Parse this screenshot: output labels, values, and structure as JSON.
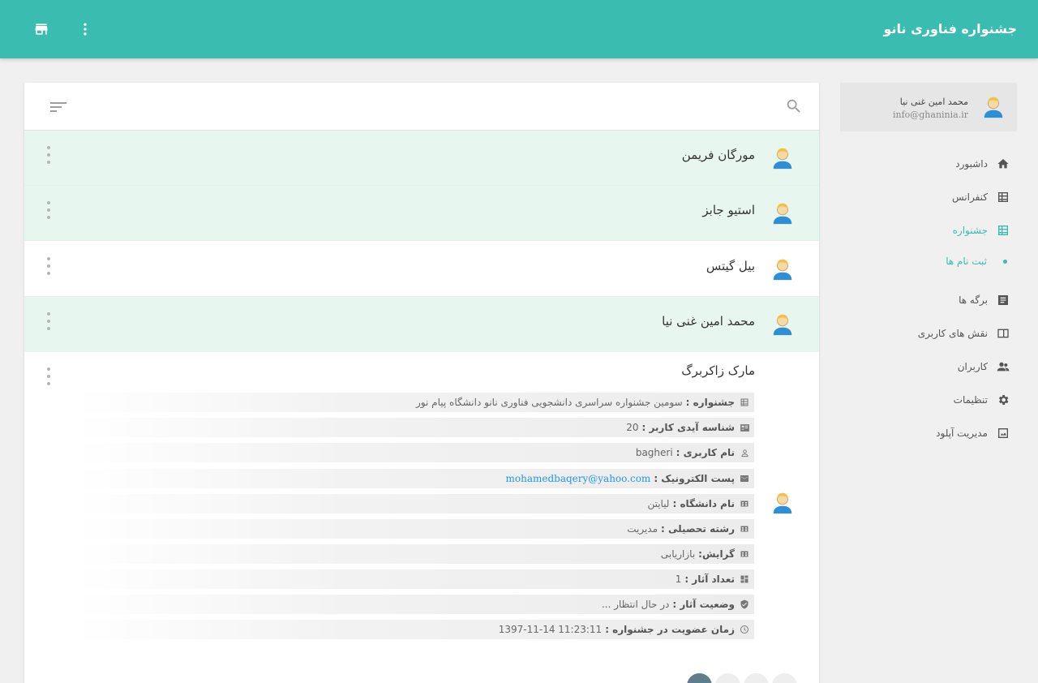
{
  "header": {
    "title": "جشنواره فناوری نانو",
    "store_icon": "store-icon",
    "menu_icon": "more-vert-icon"
  },
  "profile": {
    "name": "محمد امین غنی نیا",
    "email": "info@ghaninia.ir"
  },
  "sidebar": {
    "items": [
      {
        "label": "داشبورد",
        "icon": "home-icon"
      },
      {
        "label": "کنفرانس",
        "icon": "table-icon"
      },
      {
        "label": "جشنواره",
        "icon": "table-icon"
      },
      {
        "label": "ثبت نام ها",
        "icon": "dot"
      },
      {
        "label": "برگه ها",
        "icon": "document-icon"
      },
      {
        "label": "نقش های کاربری",
        "icon": "id-card-icon"
      },
      {
        "label": "کاربران",
        "icon": "users-icon"
      },
      {
        "label": "تنظیمات",
        "icon": "gear-icon"
      },
      {
        "label": "مدیریت آپلود",
        "icon": "image-icon"
      }
    ]
  },
  "search": {
    "placeholder": ""
  },
  "list": [
    {
      "name": "مورگان فریمن"
    },
    {
      "name": "استیو جابز"
    },
    {
      "name": "بیل گیتس"
    },
    {
      "name": "محمد امین غنی نیا"
    },
    {
      "name": "مارک زاکربرگ"
    }
  ],
  "details": [
    {
      "label": "جشنواره :",
      "value": "سومین جشنواره سراسری دانشجویی فناوری نانو دانشگاه پیام نور",
      "icon": "table-icon"
    },
    {
      "label": "شناسه آیدی کاربر :",
      "value": "20",
      "icon": "id-card-icon"
    },
    {
      "label": "نام کاربری :",
      "value": "bagheri",
      "icon": "person-icon"
    },
    {
      "label": "پست الکترونیک :",
      "value": "mohamedbaqery@yahoo.com",
      "icon": "mail-icon"
    },
    {
      "label": "نام دانشگاه :",
      "value": "لیایتن",
      "icon": "school-icon"
    },
    {
      "label": "رشته تحصیلی :",
      "value": "مدیریت",
      "icon": "school-icon"
    },
    {
      "label": "گرایش:",
      "value": "بازاریابی",
      "icon": "school-icon"
    },
    {
      "label": "تعداد آثار :",
      "value": "1",
      "icon": "dashboard-icon"
    },
    {
      "label": "وضعیت آثار :",
      "value": "در حال انتظار ...",
      "icon": "shield-icon"
    },
    {
      "label": "زمان عضویت در جشنواره :",
      "value": "1397-11-14 11:23:11",
      "icon": "clock-icon"
    }
  ],
  "colors": {
    "primary": "#3abcb1",
    "highlight_row": "#e7f6ef",
    "pager_active": "#607d8b",
    "link": "#2196f3"
  }
}
